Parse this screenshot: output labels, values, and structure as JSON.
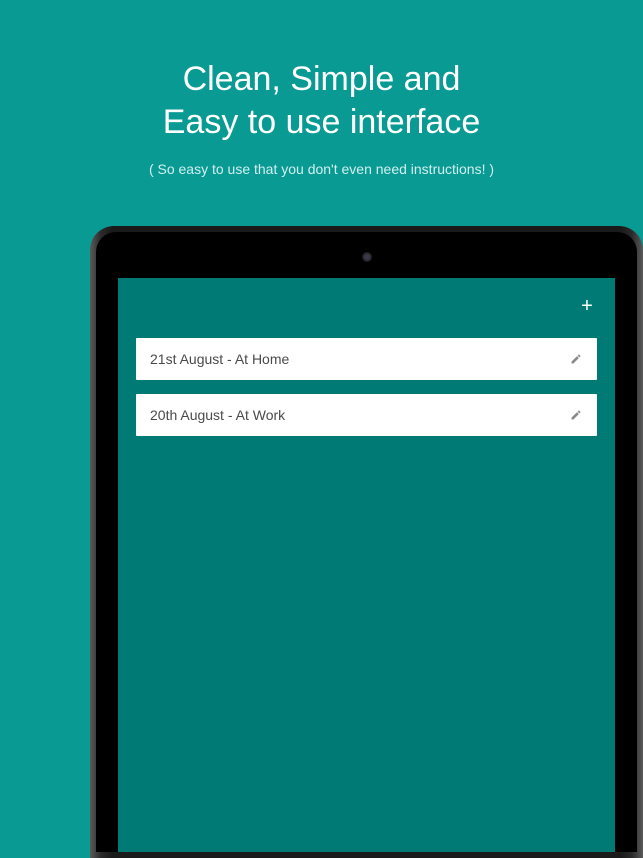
{
  "headline_line1": "Clean, Simple and",
  "headline_line2": "Easy to use interface",
  "subheadline": "( So easy to use that you don't even need instructions! )",
  "add_icon_glyph": "+",
  "items": [
    {
      "label": "21st August - At Home"
    },
    {
      "label": "20th August - At Work"
    }
  ]
}
